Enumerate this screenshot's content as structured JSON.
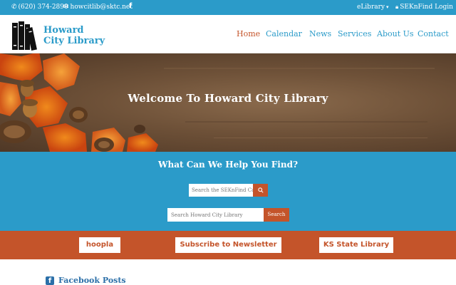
{
  "topbar": {
    "phone": "(620) 374-2890",
    "email": "howcitlib@sktc.net",
    "facebook_icon": "f",
    "elibrary": "eLibrary",
    "elibrary_arrow": "▾",
    "sekfind_login": "SEKnFind Login",
    "icons": {
      "phone": "phone-icon",
      "email": "mail-icon",
      "facebook": "facebook-icon",
      "lock": "lock-icon"
    }
  },
  "header": {
    "logo_line1": "Howard",
    "logo_line2": "City Library",
    "nav": [
      {
        "label": "Home",
        "active": true
      },
      {
        "label": "Calendar"
      },
      {
        "label": "News"
      },
      {
        "label": "Services"
      },
      {
        "label": "About Us"
      },
      {
        "label": "Contact"
      }
    ]
  },
  "hero": {
    "title": "Welcome To Howard City Library"
  },
  "search": {
    "heading": "What Can We Help You Find?",
    "catalog_placeholder": "Search the SEKnFind Catalog",
    "catalog_button_icon": "search-icon",
    "site_placeholder": "Search Howard City Library",
    "site_button": "Search"
  },
  "links": [
    {
      "label": "hoopla"
    },
    {
      "label": "Subscribe to Newsletter"
    },
    {
      "label": "KS State Library"
    }
  ],
  "facebook": {
    "icon": "f",
    "title": "Facebook Posts"
  },
  "colors": {
    "blue": "#2b9bc9",
    "orange": "#c4542a",
    "fb_blue": "#2b6fa8"
  }
}
